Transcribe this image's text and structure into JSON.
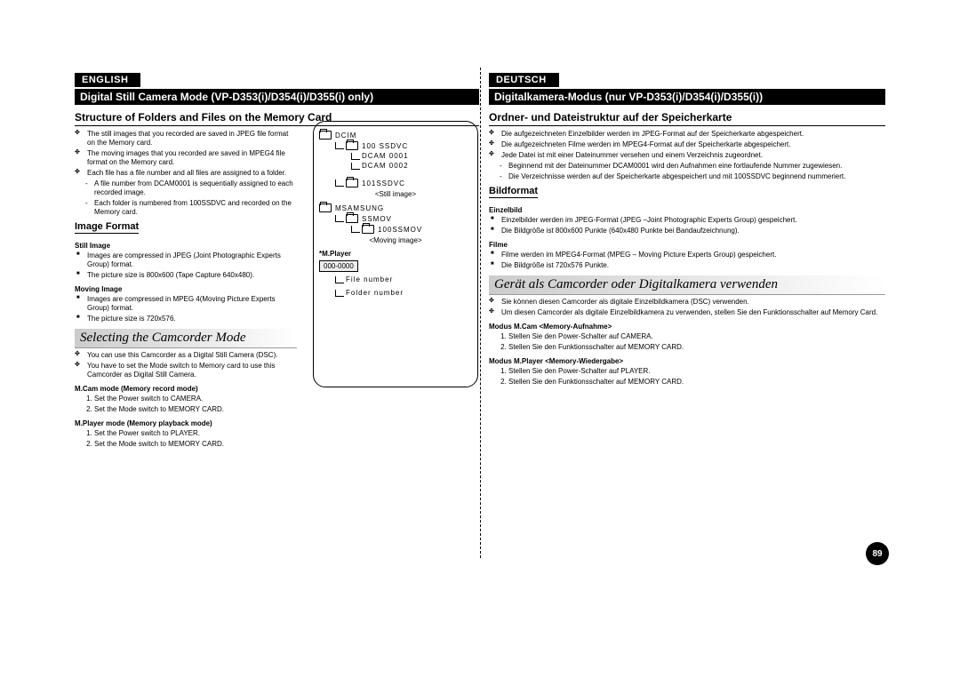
{
  "left": {
    "lang": "ENGLISH",
    "title": "Digital Still Camera Mode (VP-D353(i)/D354(i)/D355(i) only)",
    "section1": "Structure of Folders and Files on the Memory Card",
    "b1": "The still images that you recorded are saved in JPEG file format on the Memory card.",
    "b2": "The moving images that you recorded are saved in MPEG4 file format on the Memory card.",
    "b3": "Each file has a file number and all files are assigned to a folder.",
    "b3a": "A file number from DCAM0001 is sequentially assigned to each recorded image.",
    "b3b": "Each folder is numbered from 100SSDVC and recorded on the Memory card.",
    "sub_image_format": "Image Format",
    "still_h": "Still Image",
    "still_1": "Images are compressed in JPEG (Joint Photographic Experts Group) format.",
    "still_2": "The picture size is 800x600 (Tape Capture 640x480).",
    "mov_h": "Moving Image",
    "mov_1": "Images are compressed in MPEG 4(Moving Picture Experts Group) format.",
    "mov_2": "The picture size is 720x576.",
    "italic1": "Selecting the Camcorder Mode",
    "sel_1": "You can use this Camcorder as a Digital Still Camera (DSC).",
    "sel_2": "You have to set the Mode switch to Memory card to use this Camcorder as Digital Still Camera.",
    "mcam_h": "M.Cam mode (Memory record mode)",
    "mcam_1": "Set the Power switch to CAMERA.",
    "mcam_2": "Set the Mode switch to MEMORY CARD.",
    "mplay_h": "M.Player mode (Memory playback mode)",
    "mplay_1": "Set the Power switch to PLAYER.",
    "mplay_2": "Set the Mode switch to MEMORY CARD."
  },
  "right": {
    "lang": "DEUTSCH",
    "title": "Digitalkamera-Modus (nur VP-D353(i)/D354(i)/D355(i))",
    "section1": "Ordner- und Dateistruktur auf der Speicherkarte",
    "b1": "Die aufgezeichneten Einzelbilder werden im JPEG-Format auf der Speicherkarte abgespeichert.",
    "b2": "Die aufgezeichneten Filme werden im MPEG4-Format auf der Speicherkarte abgespeichert.",
    "b3": "Jede Datei ist mit einer Dateinummer versehen und einem Verzeichnis zugeordnet.",
    "b3a": "Beginnend mit der Dateinummer DCAM0001 wird den Aufnahmen eine fortlaufende Nummer zugewiesen.",
    "b3b": "Die Verzeichnisse werden auf der Speicherkarte abgespeichert und mit 100SSDVC beginnend nummeriert.",
    "sub_bild": "Bildformat",
    "einz_h": "Einzelbild",
    "einz_1": "Einzelbilder werden im JPEG-Format (JPEG –Joint Photographic Experts Group) gespeichert.",
    "einz_2": "Die Bildgröße ist 800x600 Punkte (640x480 Punkte bei Bandaufzeichnung).",
    "film_h": "Filme",
    "film_1": "Filme werden im MPEG4-Format (MPEG – Moving Picture Experts Group) gespeichert.",
    "film_2": "Die Bildgröße ist 720x576 Punkte.",
    "italic1": "Gerät als Camcorder oder Digitalkamera verwenden",
    "sel_1": "Sie können diesen Camcorder als digitale Einzelbildkamera (DSC) verwenden.",
    "sel_2": "Um diesen Camcorder als digitale Einzelbildkamera zu verwenden, stellen Sie den Funktionsschalter auf Memory Card.",
    "mcam_h": "Modus M.Cam <Memory-Aufnahme>",
    "mcam_1": "Stellen Sie den Power-Schalter auf CAMERA.",
    "mcam_2": "Stellen Sie den Funktionsschalter auf MEMORY CARD.",
    "mplay_h": "Modus M.Player <Memory-Wiedergabe>",
    "mplay_1": "Stellen Sie den Power-Schalter auf PLAYER.",
    "mplay_2": "Stellen Sie den Funktionsschalter auf MEMORY CARD."
  },
  "diagram": {
    "t1_root": "DCIM",
    "t1_a": "100 SSDVC",
    "t1_b": "DCAM 0001",
    "t1_c": "DCAM 0002",
    "t1_d": "101SSDVC",
    "cap1": "<Still image>",
    "t2_root": "MSAMSUNG",
    "t2_a": "SSMOV",
    "t2_b": "100SSMOV",
    "cap2": "<Moving image>",
    "mplayer_h": "*M.Player",
    "filebox": "000-0000",
    "filenum": "File number",
    "foldernum": "Folder number"
  },
  "pagenum": "89"
}
